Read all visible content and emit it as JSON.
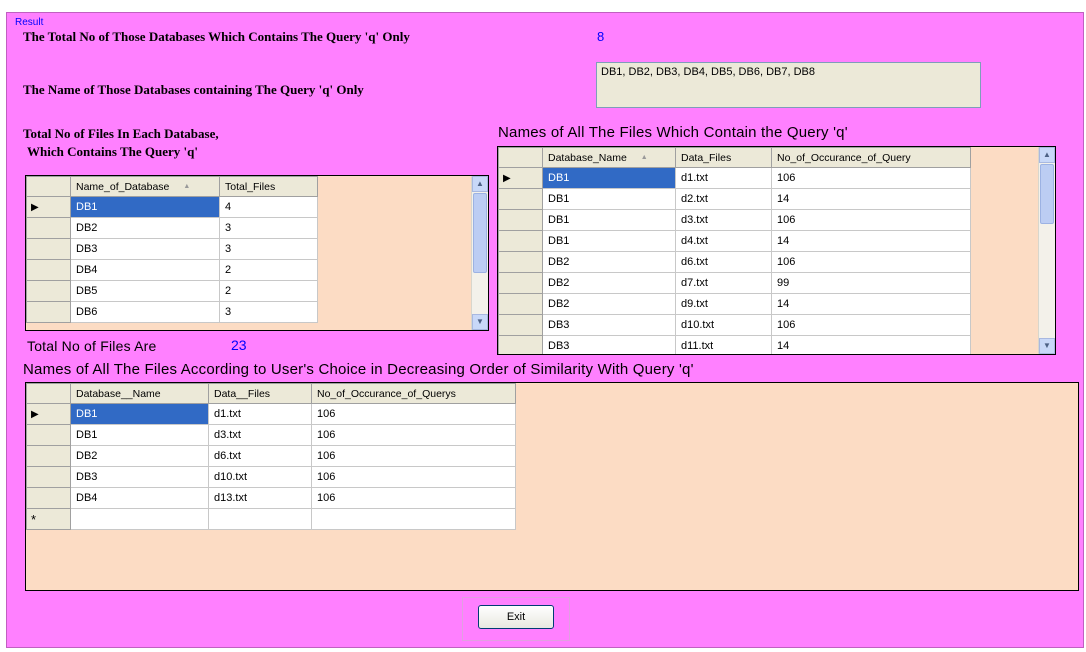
{
  "group_caption": "Result",
  "total_db_label": "The Total No of Those Databases Which Contains The Query 'q' Only",
  "total_db_value": "8",
  "db_names_label": "The Name of Those Databases containing The Query 'q' Only",
  "db_names_value": "DB1, DB2, DB3, DB4, DB5, DB6, DB7, DB8",
  "files_each_db_label_1": "Total No of Files In Each Database,",
  "files_each_db_label_2": "Which Contains The Query 'q'",
  "all_files_label": "Names of All The Files Which Contain the Query 'q'",
  "total_files_label": "Total No of Files Are",
  "total_files_value": "23",
  "choice_label": "Names of All The Files According to User's Choice in Decreasing Order of Similarity With Query 'q'",
  "grid1": {
    "columns": [
      "Name_of_Database",
      "Total_Files"
    ],
    "rows": [
      [
        "DB1",
        "4"
      ],
      [
        "DB2",
        "3"
      ],
      [
        "DB3",
        "3"
      ],
      [
        "DB4",
        "2"
      ],
      [
        "DB5",
        "2"
      ],
      [
        "DB6",
        "3"
      ]
    ]
  },
  "grid2": {
    "columns": [
      "Database_Name",
      "Data_Files",
      "No_of_Occurance_of_Query"
    ],
    "rows": [
      [
        "DB1",
        "d1.txt",
        "106"
      ],
      [
        "DB1",
        "d2.txt",
        "14"
      ],
      [
        "DB1",
        "d3.txt",
        "106"
      ],
      [
        "DB1",
        "d4.txt",
        "14"
      ],
      [
        "DB2",
        "d6.txt",
        "106"
      ],
      [
        "DB2",
        "d7.txt",
        "99"
      ],
      [
        "DB2",
        "d9.txt",
        "14"
      ],
      [
        "DB3",
        "d10.txt",
        "106"
      ],
      [
        "DB3",
        "d11.txt",
        "14"
      ]
    ]
  },
  "grid3": {
    "columns": [
      "Database__Name",
      "Data__Files",
      "No_of_Occurance_of_Querys"
    ],
    "rows": [
      [
        "DB1",
        "d1.txt",
        "106"
      ],
      [
        "DB1",
        "d3.txt",
        "106"
      ],
      [
        "DB2",
        "d6.txt",
        "106"
      ],
      [
        "DB3",
        "d10.txt",
        "106"
      ],
      [
        "DB4",
        "d13.txt",
        "106"
      ]
    ],
    "new_row_marker": "*"
  },
  "current_row_marker": "▶",
  "exit_label": "Exit",
  "colors": {
    "form_background": "#ff80ff",
    "grid_background": "#fcdcc4",
    "selection": "#316ac5",
    "value_text": "#0000ff"
  },
  "icons": {
    "scroll_up": "chevron-up-icon",
    "scroll_down": "chevron-down-icon",
    "sort": "sort-ascending-icon",
    "current_row": "row-pointer-icon"
  }
}
